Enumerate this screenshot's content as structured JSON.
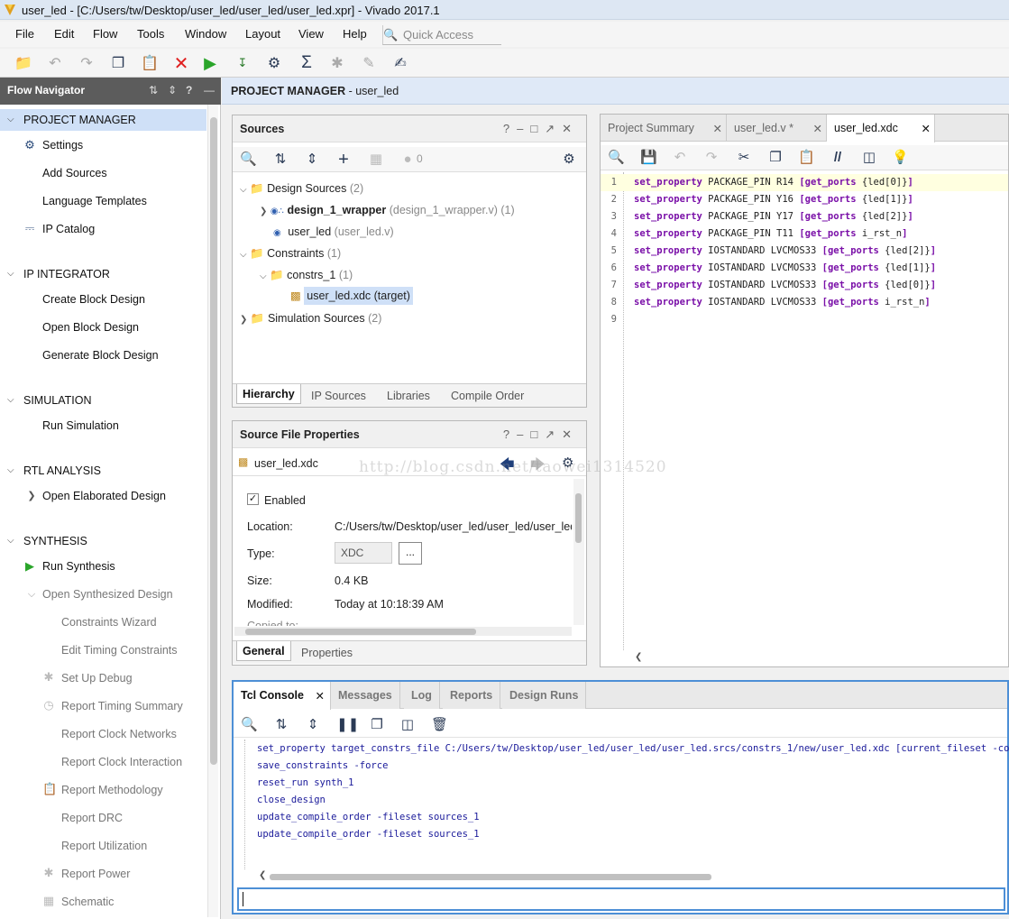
{
  "window": {
    "title": "user_led - [C:/Users/tw/Desktop/user_led/user_led/user_led.xpr] - Vivado 2017.1"
  },
  "menu": [
    "File",
    "Edit",
    "Flow",
    "Tools",
    "Window",
    "Layout",
    "View",
    "Help"
  ],
  "quick_access": {
    "placeholder": "Quick Access"
  },
  "flow_navigator": {
    "title": "Flow Navigator",
    "sections": [
      {
        "label": "PROJECT MANAGER",
        "items": [
          "Settings",
          "Add Sources",
          "Language Templates",
          "IP Catalog"
        ]
      },
      {
        "label": "IP INTEGRATOR",
        "items": [
          "Create Block Design",
          "Open Block Design",
          "Generate Block Design"
        ]
      },
      {
        "label": "SIMULATION",
        "items": [
          "Run Simulation"
        ]
      },
      {
        "label": "RTL ANALYSIS",
        "items": [
          "Open Elaborated Design"
        ]
      },
      {
        "label": "SYNTHESIS",
        "items": [
          "Run Synthesis",
          "Open Synthesized Design",
          "Constraints Wizard",
          "Edit Timing Constraints",
          "Set Up Debug",
          "Report Timing Summary",
          "Report Clock Networks",
          "Report Clock Interaction",
          "Report Methodology",
          "Report DRC",
          "Report Utilization",
          "Report Power",
          "Schematic"
        ]
      }
    ]
  },
  "project_bar": {
    "prefix": "PROJECT MANAGER",
    "sep": " - ",
    "name": "user_led"
  },
  "sources": {
    "title": "Sources",
    "badge_count": "0",
    "tree": {
      "design_sources": "Design Sources",
      "design_sources_count": "(2)",
      "wrapper": "design_1_wrapper",
      "wrapper_detail": "(design_1_wrapper.v) (1)",
      "user_led": "user_led",
      "user_led_detail": "(user_led.v)",
      "constraints": "Constraints",
      "constraints_count": "(1)",
      "constrs": "constrs_1",
      "constrs_count": "(1)",
      "xdc": "user_led.xdc (target)",
      "sim_sources": "Simulation Sources",
      "sim_sources_count": "(2)"
    },
    "tabs": [
      "Hierarchy",
      "IP Sources",
      "Libraries",
      "Compile Order"
    ]
  },
  "file_props": {
    "title": "Source File Properties",
    "file": "user_led.xdc",
    "enabled": "Enabled",
    "location_label": "Location:",
    "location": "C:/Users/tw/Desktop/user_led/user_led/user_led",
    "type_label": "Type:",
    "type": "XDC",
    "type_btn": "...",
    "size_label": "Size:",
    "size": "0.4 KB",
    "modified_label": "Modified:",
    "modified": "Today at 10:18:39 AM",
    "copied_label": "Copied to:",
    "tabs": [
      "General",
      "Properties"
    ]
  },
  "editor": {
    "tabs": [
      "Project Summary",
      "user_led.v *",
      "user_led.xdc"
    ],
    "lines": [
      {
        "n": "1",
        "cmd": "set_property",
        "mid": " PACKAGE_PIN R14 ",
        "gp": "[get_ports",
        "arg": " {led[0]}",
        "end": "]"
      },
      {
        "n": "2",
        "cmd": "set_property",
        "mid": " PACKAGE_PIN Y16 ",
        "gp": "[get_ports",
        "arg": " {led[1]}",
        "end": "]"
      },
      {
        "n": "3",
        "cmd": "set_property",
        "mid": " PACKAGE_PIN Y17 ",
        "gp": "[get_ports",
        "arg": " {led[2]}",
        "end": "]"
      },
      {
        "n": "4",
        "cmd": "set_property",
        "mid": " PACKAGE_PIN T11 ",
        "gp": "[get_ports",
        "arg": " i_rst_n",
        "end": "]"
      },
      {
        "n": "5",
        "cmd": "set_property",
        "mid": " IOSTANDARD LVCMOS33 ",
        "gp": "[get_ports",
        "arg": " {led[2]}",
        "end": "]"
      },
      {
        "n": "6",
        "cmd": "set_property",
        "mid": " IOSTANDARD LVCMOS33 ",
        "gp": "[get_ports",
        "arg": " {led[1]}",
        "end": "]"
      },
      {
        "n": "7",
        "cmd": "set_property",
        "mid": " IOSTANDARD LVCMOS33 ",
        "gp": "[get_ports",
        "arg": " {led[0]}",
        "end": "]"
      },
      {
        "n": "8",
        "cmd": "set_property",
        "mid": " IOSTANDARD LVCMOS33 ",
        "gp": "[get_ports",
        "arg": " i_rst_n",
        "end": "]"
      },
      {
        "n": "9",
        "cmd": "",
        "mid": "",
        "gp": "",
        "arg": "",
        "end": ""
      }
    ]
  },
  "watermark": "http://blog.csdn.net/taowei1314520",
  "console": {
    "tabs": [
      "Tcl Console",
      "Messages",
      "Log",
      "Reports",
      "Design Runs"
    ],
    "lines": [
      "set_property target_constrs_file C:/Users/tw/Desktop/user_led/user_led/user_led.srcs/constrs_1/new/user_led.xdc [current_fileset -constrset",
      "save_constraints -force",
      "reset_run synth_1",
      "close_design",
      "update_compile_order -fileset sources_1",
      "update_compile_order -fileset sources_1"
    ]
  },
  "colors": {
    "accent": "#4d8fd6",
    "keyword": "#7a10a8",
    "console_text": "#1a1a9a",
    "run_green": "#2aa52a",
    "stop_red": "#e02020"
  }
}
